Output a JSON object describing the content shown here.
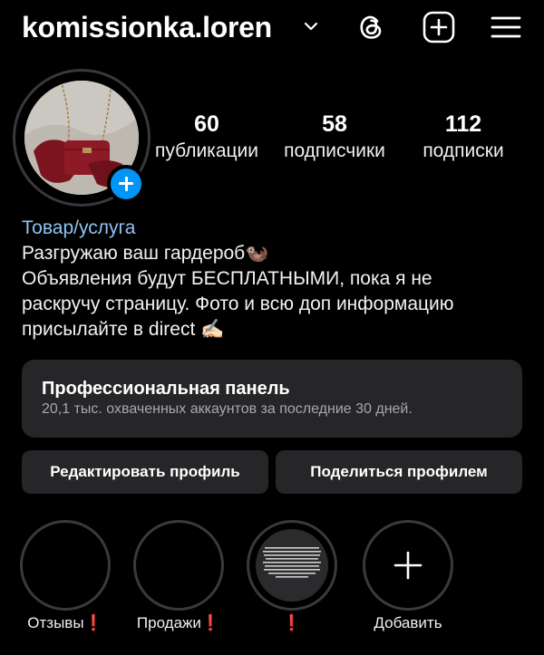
{
  "header": {
    "username": "komissionka.loren",
    "icons": [
      "chevron-down-icon",
      "threads-icon",
      "plus-square-icon",
      "menu-icon"
    ]
  },
  "profile": {
    "avatar": "handbag-photo",
    "stats": [
      {
        "value": "60",
        "label": "публикации"
      },
      {
        "value": "58",
        "label": "подписчики"
      },
      {
        "value": "112",
        "label": "подписки"
      }
    ],
    "category": "Товар/услуга",
    "bio_lines": [
      "Разгружаю ваш гардероб🦦",
      "Объявления будут БЕСПЛАТНЫМИ, пока я не",
      "раскручу страницу. Фото и всю доп информацию",
      "присылайте в direct ✍🏻"
    ]
  },
  "dashboard": {
    "title": "Профессиональная панель",
    "subtitle": "20,1 тыс. охваченных аккаунтов за последние 30 дней."
  },
  "buttons": {
    "edit": "Редактировать профиль",
    "share": "Поделиться профилем"
  },
  "highlights": [
    {
      "label": "Отзывы",
      "mark": "❗"
    },
    {
      "label": "Продажи",
      "mark": "❗"
    },
    {
      "label": "",
      "mark": "❗"
    },
    {
      "label": "Добавить",
      "mark": ""
    }
  ],
  "colors": {
    "background": "#000000",
    "accent_blue": "#0095f6",
    "category_link": "#8fc3f5",
    "card": "#262629",
    "alert_red": "#e0132f"
  }
}
